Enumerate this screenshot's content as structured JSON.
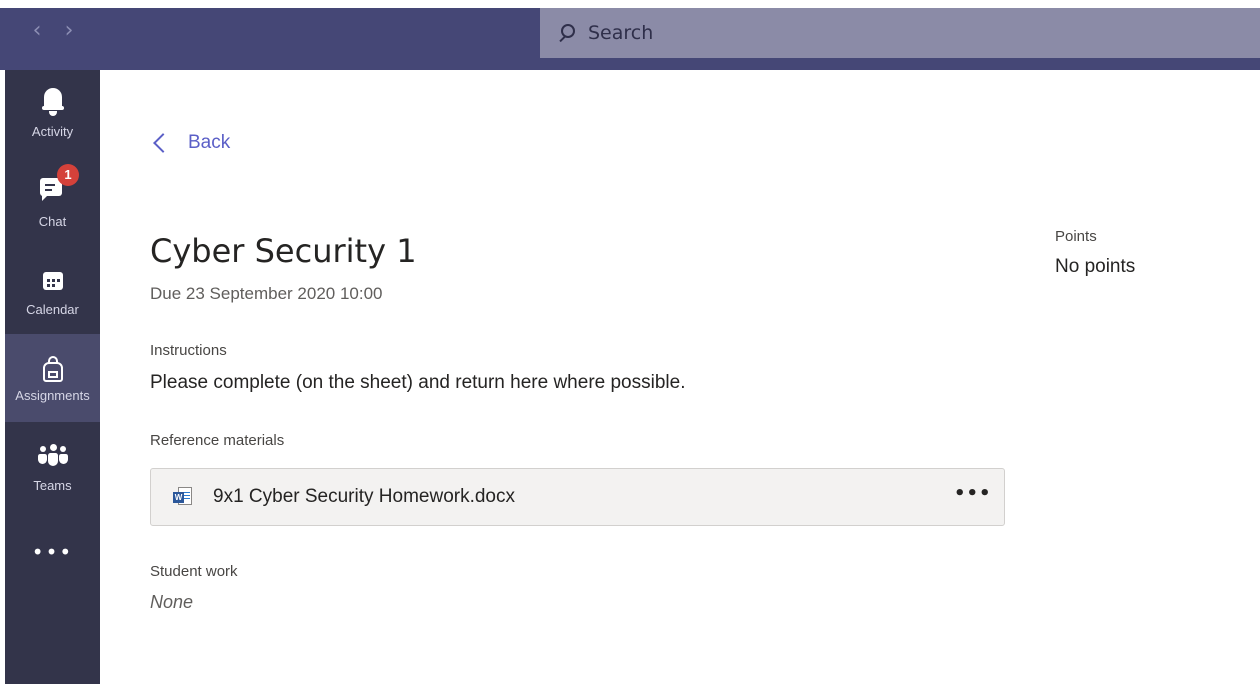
{
  "titlebar": {
    "back_arrow": "‹",
    "forward_arrow": "›",
    "search_placeholder": "Search",
    "search_icon": "search-icon",
    "color": "#454776"
  },
  "rail": {
    "items": [
      {
        "label": "Activity",
        "icon": "bell-icon"
      },
      {
        "label": "Chat",
        "icon": "chat-icon",
        "badge": "1"
      },
      {
        "label": "Calendar",
        "icon": "calendar-icon"
      },
      {
        "label": "Assignments",
        "icon": "backpack-icon",
        "active": true
      },
      {
        "label": "Teams",
        "icon": "teams-icon"
      }
    ],
    "more": "•••",
    "background": "#33344a"
  },
  "main": {
    "back_label": "Back",
    "title": "Cyber Security 1",
    "due": "Due 23 September 2020 10:00",
    "instructions_label": "Instructions",
    "instructions_text": "Please complete (on the sheet) and return here where possible.",
    "reference_label": "Reference materials",
    "reference_file": {
      "name": "9x1 Cyber Security Homework.docx",
      "icon": "word-doc-icon",
      "more": "•••"
    },
    "student_work_label": "Student work",
    "student_work_value": "None",
    "accent": "#5b5fc7"
  },
  "points": {
    "label": "Points",
    "value": "No points"
  }
}
